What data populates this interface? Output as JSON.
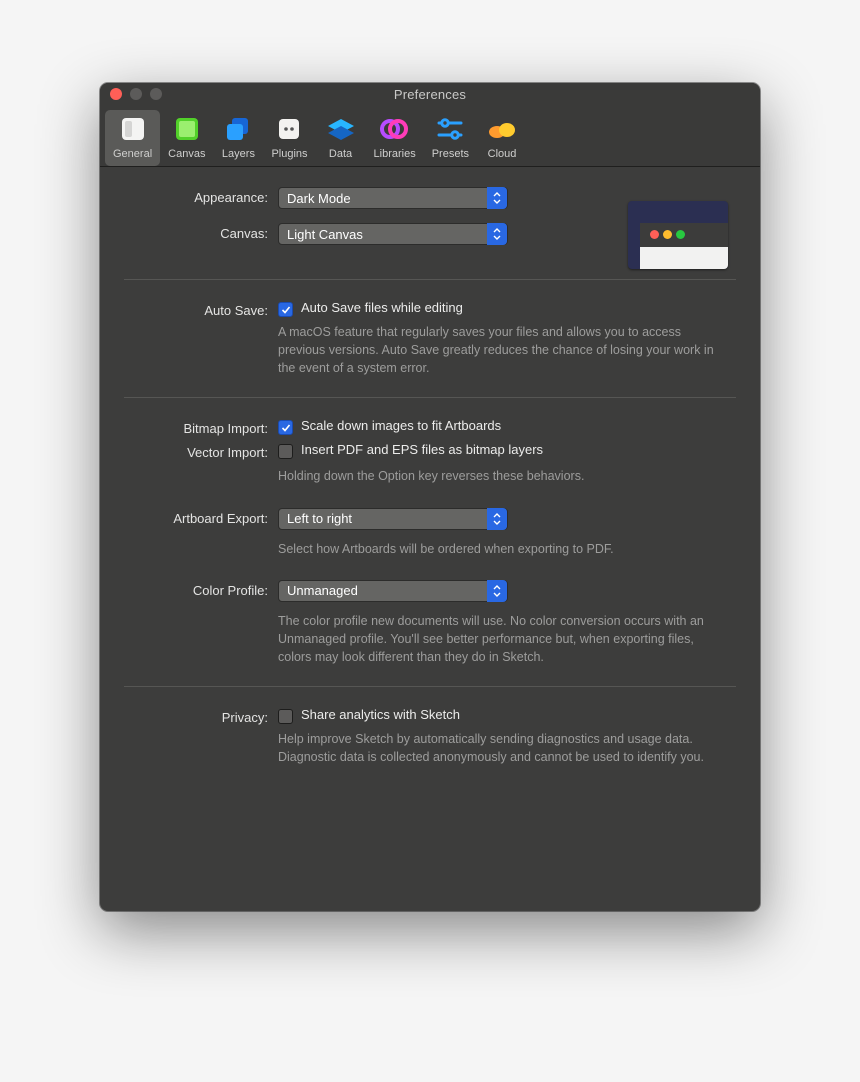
{
  "window": {
    "title": "Preferences"
  },
  "tabs": [
    {
      "name": "general",
      "label": "General"
    },
    {
      "name": "canvas",
      "label": "Canvas"
    },
    {
      "name": "layers",
      "label": "Layers"
    },
    {
      "name": "plugins",
      "label": "Plugins"
    },
    {
      "name": "data",
      "label": "Data"
    },
    {
      "name": "libraries",
      "label": "Libraries"
    },
    {
      "name": "presets",
      "label": "Presets"
    },
    {
      "name": "cloud",
      "label": "Cloud"
    }
  ],
  "labels": {
    "appearance": "Appearance:",
    "canvas": "Canvas:",
    "auto_save": "Auto Save:",
    "bitmap_import": "Bitmap Import:",
    "vector_import": "Vector Import:",
    "artboard_export": "Artboard Export:",
    "color_profile": "Color Profile:",
    "privacy": "Privacy:"
  },
  "values": {
    "appearance": "Dark Mode",
    "canvas": "Light Canvas",
    "artboard_export": "Left to right",
    "color_profile": "Unmanaged"
  },
  "checks": {
    "auto_save_label": "Auto Save files while editing",
    "auto_save_help": "A macOS feature that regularly saves your files and allows you to access previous versions. Auto Save greatly reduces the chance of losing your work in the event of a system error.",
    "bitmap_label": "Scale down images to fit Artboards",
    "vector_label": "Insert PDF and EPS files as bitmap layers",
    "import_help": "Holding down the Option key reverses these behaviors.",
    "artboard_help": "Select how Artboards will be ordered when exporting to PDF.",
    "color_help": "The color profile new documents will use. No color conversion occurs with an Unmanaged profile. You'll see better performance but, when exporting files, colors may look different than they do in Sketch.",
    "privacy_label": "Share analytics with Sketch",
    "privacy_help": "Help improve Sketch by automatically sending diagnostics and usage data. Diagnostic data is collected anonymously and cannot be used to identify you."
  }
}
